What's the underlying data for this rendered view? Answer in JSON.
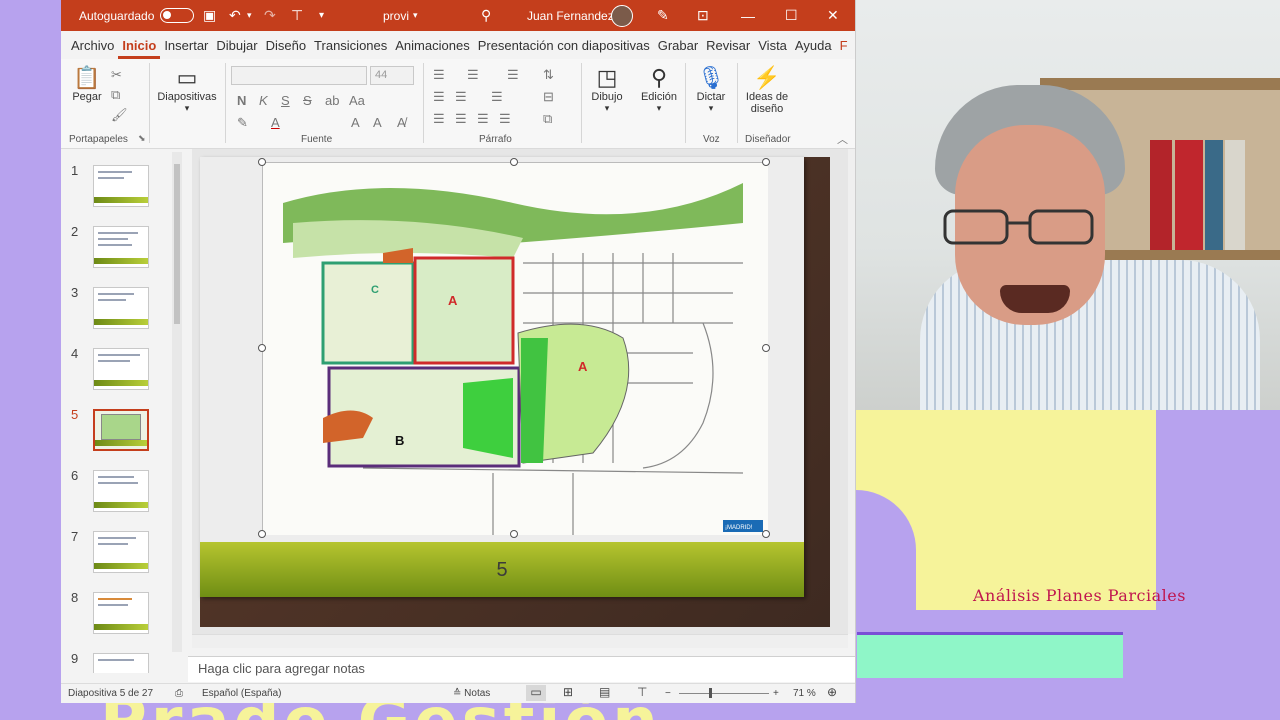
{
  "titlebar": {
    "autosave_label": "Autoguardado",
    "doc_name": "provi",
    "user_name": "Juan Fernandez"
  },
  "menu": {
    "tabs": [
      "Archivo",
      "Inicio",
      "Insertar",
      "Dibujar",
      "Diseño",
      "Transiciones",
      "Animaciones",
      "Presentación con diapositivas",
      "Grabar",
      "Revisar",
      "Vista",
      "Ayuda",
      "F"
    ],
    "active": "Inicio"
  },
  "ribbon": {
    "paste_label": "Pegar",
    "slides_label": "Diapositivas",
    "font_size": "44",
    "draw_label": "Dibujo",
    "edit_label": "Edición",
    "dictate_label": "Dictar",
    "ideas_label": "Ideas de diseño",
    "groups": {
      "clipboard": "Portapapeles",
      "font": "Fuente",
      "paragraph": "Párrafo",
      "voice": "Voz",
      "designer": "Diseñador"
    }
  },
  "thumbnails": [
    "1",
    "2",
    "3",
    "4",
    "5",
    "6",
    "7",
    "8",
    "9"
  ],
  "selected_slide": "5",
  "slide": {
    "number": "5",
    "map_labels": {
      "a1": "A",
      "a2": "A",
      "b": "B",
      "c": "C",
      "logo": "¡MADRID!"
    }
  },
  "notes_placeholder": "Haga clic para agregar notas",
  "status": {
    "slide_info": "Diapositiva 5 de 27",
    "language": "Español (España)",
    "notes_label": "Notas",
    "zoom": "71 %"
  },
  "overlay": {
    "subtitle": "Análisis Planes Parciales",
    "bigtext": "Prado Gestión"
  }
}
